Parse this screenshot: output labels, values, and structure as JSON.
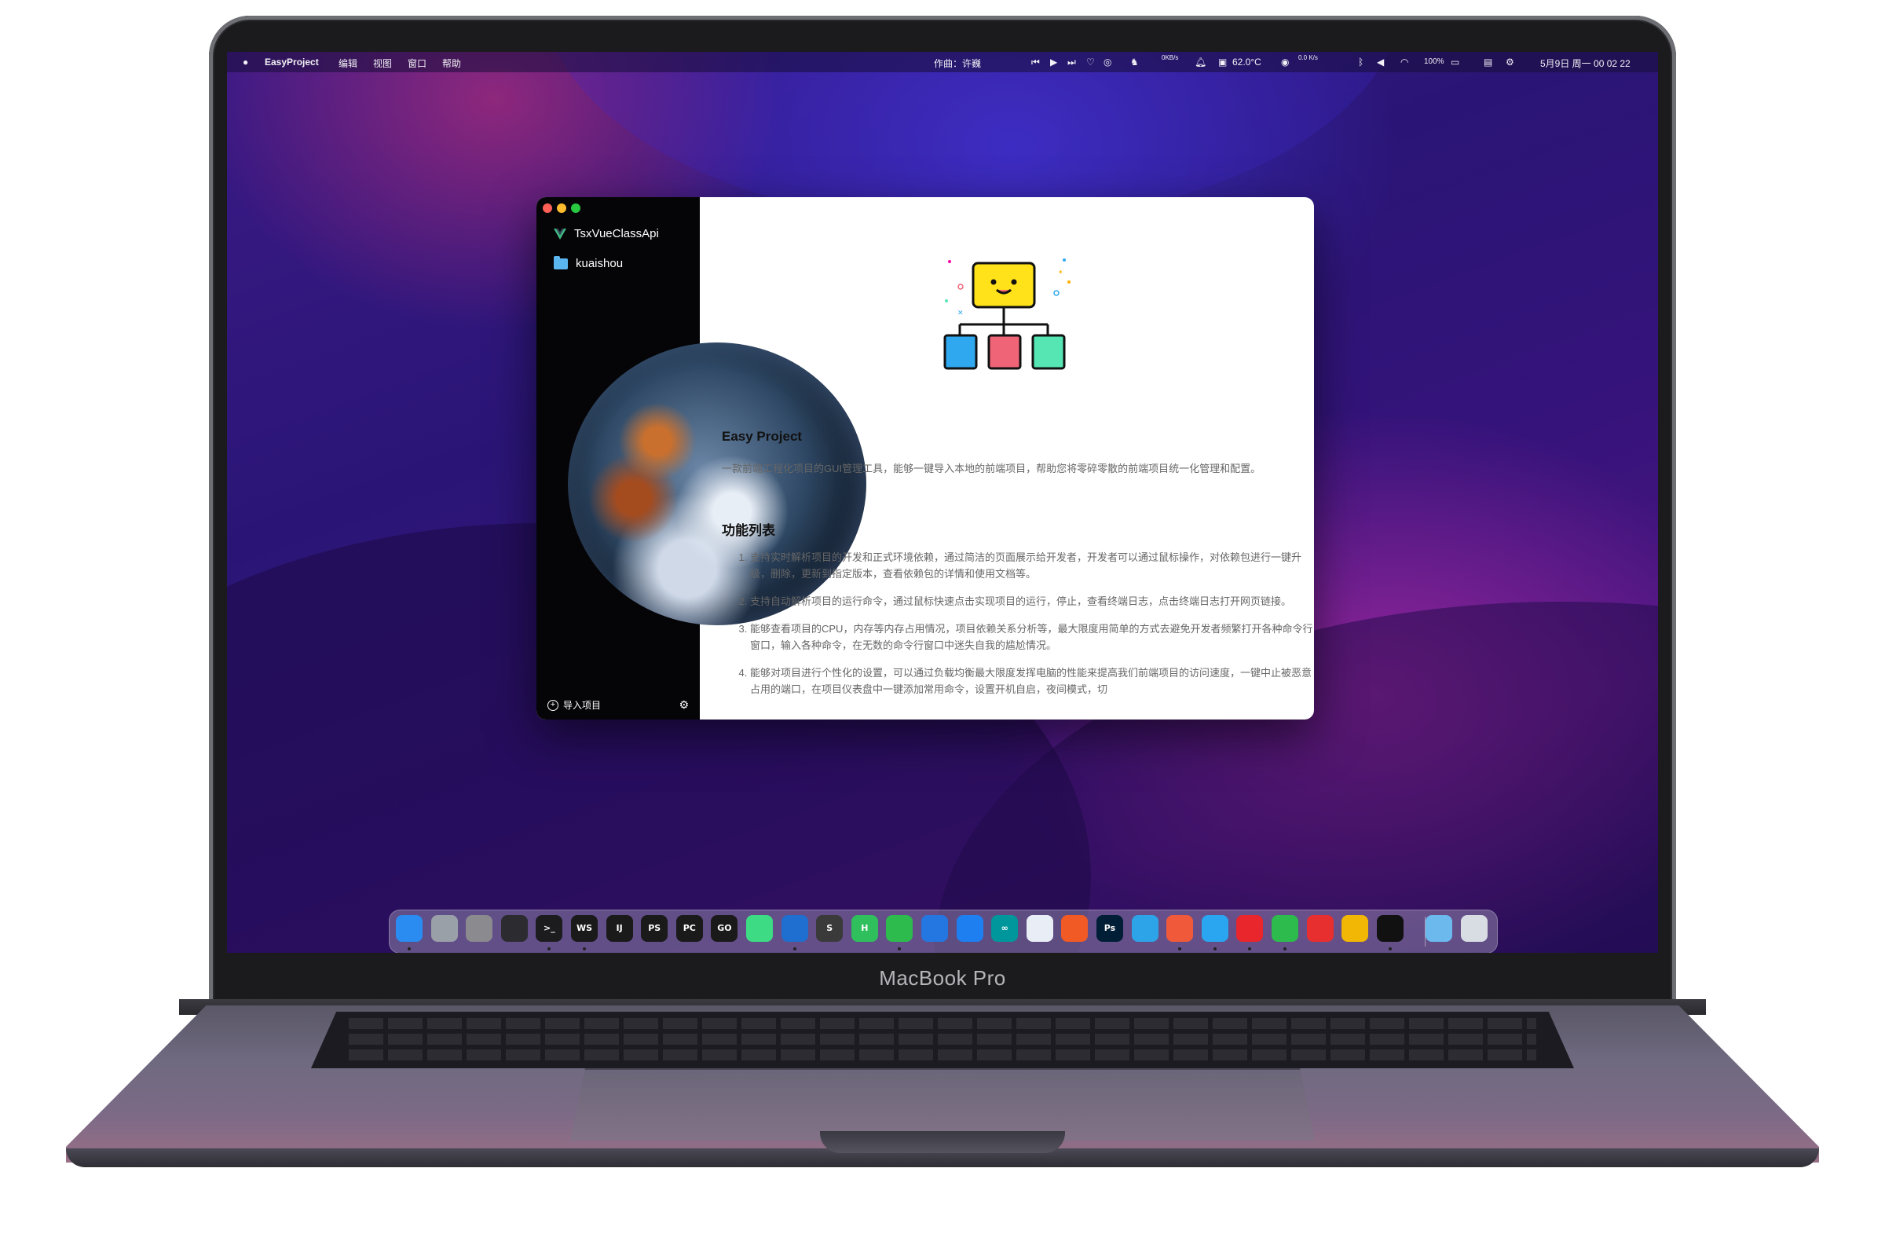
{
  "menubar": {
    "app_name": "EasyProject",
    "menus": [
      "编辑",
      "视图",
      "窗口",
      "帮助"
    ],
    "now_playing": "作曲：许巍",
    "net_speed": "0KB/s",
    "temperature": "62.0°C",
    "speed_up": "0.0 K/s",
    "battery": "100%",
    "datetime": "5月9日 周一  00 02 22"
  },
  "sidebar": {
    "projects": [
      {
        "label": "TsxVueClassApi",
        "icon": "vue-icon"
      },
      {
        "label": "kuaishou",
        "icon": "folder-icon"
      }
    ],
    "import_label": "导入项目"
  },
  "content": {
    "title": "Easy Project",
    "description": "一款前端工程化项目的GUI管理工具，能够一键导入本地的前端项目，帮助您将零碎零散的前端项目统一化管理和配置。",
    "features_heading": "功能列表",
    "features": [
      "支持实时解析项目的开发和正式环境依赖，通过简洁的页面展示给开发者，开发者可以通过鼠标操作，对依赖包进行一键升级，删除，更新到指定版本，查看依赖包的详情和使用文档等。",
      "支持自动解析项目的运行命令，通过鼠标快速点击实现项目的运行，停止，查看终端日志，点击终端日志打开网页链接。",
      "能够查看项目的CPU，内存等内存占用情况，项目依赖关系分析等，最大限度用简单的方式去避免开发者频繁打开各种命令行窗口，输入各种命令，在无数的命令行窗口中迷失自我的尴尬情况。",
      "能够对项目进行个性化的设置，可以通过负载均衡最大限度发挥电脑的性能来提高我们前端项目的访问速度，一键中止被恶意占用的端口，在项目仪表盘中一键添加常用命令，设置开机自启，夜间模式，切"
    ]
  },
  "laptop": {
    "model_label": "MacBook Pro"
  },
  "dock": {
    "icons": [
      {
        "name": "finder-icon",
        "text": "",
        "color": "#2a8cf0"
      },
      {
        "name": "launchpad-icon",
        "text": "",
        "color": "#9aa0a8"
      },
      {
        "name": "system-preferences-icon",
        "text": "",
        "color": "#8a8a8f"
      },
      {
        "name": "activity-monitor-icon",
        "text": "",
        "color": "#2c2c30"
      },
      {
        "name": "terminal-icon",
        "text": ">_",
        "color": "#1c1c1e"
      },
      {
        "name": "webstorm-icon",
        "text": "WS",
        "color": "#1a1a1a"
      },
      {
        "name": "intellij-icon",
        "text": "IJ",
        "color": "#1a1a1a"
      },
      {
        "name": "phpstorm-icon",
        "text": "PS",
        "color": "#1a1a1a"
      },
      {
        "name": "pycharm-icon",
        "text": "PC",
        "color": "#1a1a1a"
      },
      {
        "name": "goland-icon",
        "text": "GO",
        "color": "#1a1a1a"
      },
      {
        "name": "android-studio-icon",
        "text": "",
        "color": "#3ddc84"
      },
      {
        "name": "vscode-icon",
        "text": "",
        "color": "#1f6fd0"
      },
      {
        "name": "sublime-text-icon",
        "text": "S",
        "color": "#3a3a3a"
      },
      {
        "name": "hbuilder-icon",
        "text": "H",
        "color": "#2fbf5d"
      },
      {
        "name": "wechat-devtools-icon",
        "text": "",
        "color": "#2dbb4e"
      },
      {
        "name": "xcode-icon",
        "text": "",
        "color": "#2476e0"
      },
      {
        "name": "instruments-icon",
        "text": "",
        "color": "#1d7ff0"
      },
      {
        "name": "arduino-icon",
        "text": "∞",
        "color": "#00979c"
      },
      {
        "name": "sourcetree-icon",
        "text": "",
        "color": "#e9eef6"
      },
      {
        "name": "pencil-app-icon",
        "text": "",
        "color": "#f15a24"
      },
      {
        "name": "photoshop-icon",
        "text": "Ps",
        "color": "#001e36"
      },
      {
        "name": "database-icon",
        "text": "",
        "color": "#2ea4e8"
      },
      {
        "name": "calendar-app-icon",
        "text": "",
        "color": "#f05a3a"
      },
      {
        "name": "qq-icon",
        "text": "",
        "color": "#2aa6f0"
      },
      {
        "name": "netease-music-icon",
        "text": "",
        "color": "#e8262c"
      },
      {
        "name": "wechat-icon",
        "text": "",
        "color": "#2dbb4e"
      },
      {
        "name": "qq-alt-icon",
        "text": "",
        "color": "#e82f2f"
      },
      {
        "name": "chrome-icon",
        "text": "",
        "color": "#f2b705"
      },
      {
        "name": "easyproject-icon",
        "text": "",
        "color": "#111"
      },
      {
        "name": "folder-icon",
        "text": "",
        "color": "#6cb9ee"
      },
      {
        "name": "trash-icon",
        "text": "",
        "color": "#d8dde4"
      }
    ]
  }
}
